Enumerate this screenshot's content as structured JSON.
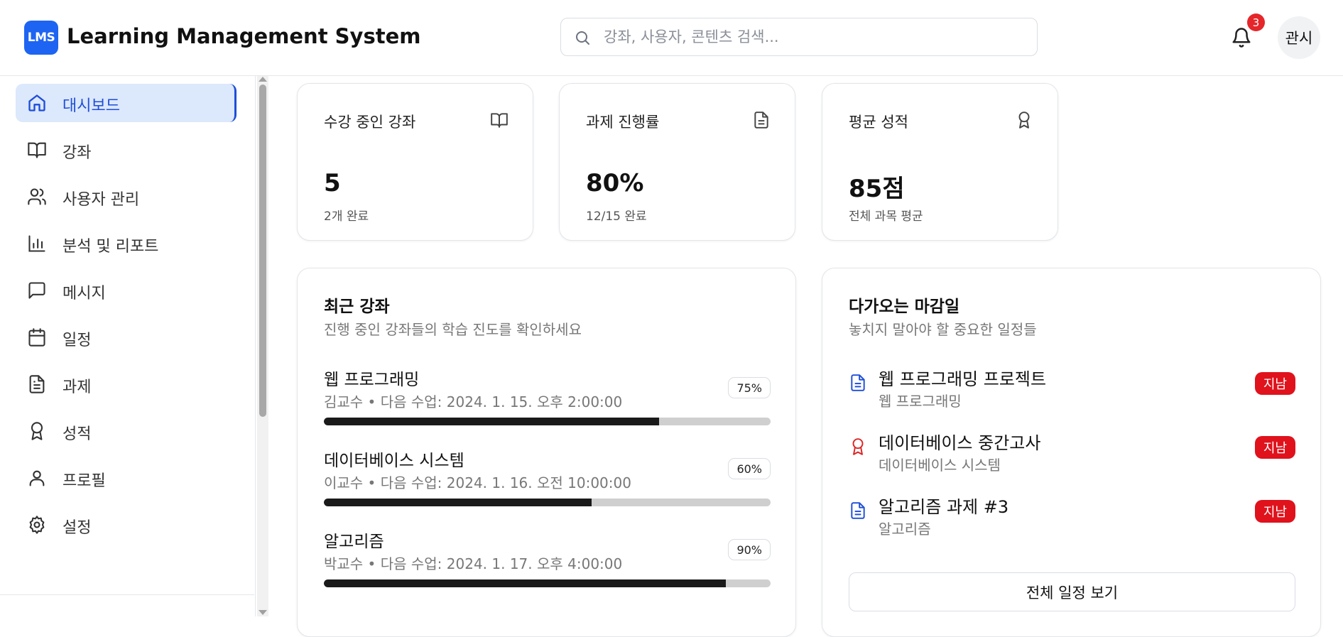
{
  "header": {
    "logo_text": "LMS",
    "app_title": "Learning Management System",
    "search_placeholder": "강좌, 사용자, 콘텐츠 검색...",
    "notification_count": "3",
    "user_name": "관시"
  },
  "sidebar": {
    "items": [
      {
        "label": "대시보드",
        "icon": "home-icon",
        "active": true
      },
      {
        "label": "강좌",
        "icon": "book-open-icon"
      },
      {
        "label": "사용자 관리",
        "icon": "users-icon"
      },
      {
        "label": "분석 및 리포트",
        "icon": "bar-chart-icon"
      },
      {
        "label": "메시지",
        "icon": "message-square-icon"
      },
      {
        "label": "일정",
        "icon": "calendar-icon"
      },
      {
        "label": "과제",
        "icon": "file-text-icon"
      },
      {
        "label": "성적",
        "icon": "award-icon"
      },
      {
        "label": "프로필",
        "icon": "user-icon"
      },
      {
        "label": "설정",
        "icon": "settings-icon"
      }
    ]
  },
  "stats": [
    {
      "title": "수강 중인 강좌",
      "value": "5",
      "sub": "2개 완료",
      "icon": "book-open-icon"
    },
    {
      "title": "과제 진행률",
      "value": "80%",
      "sub": "12/15 완료",
      "icon": "file-text-icon"
    },
    {
      "title": "평균 성적",
      "value": "85점",
      "sub": "전체 과목 평균",
      "icon": "award-icon"
    }
  ],
  "recent_courses": {
    "title": "최근 강좌",
    "subtitle": "진행 중인 강좌들의 학습 진도를 확인하세요",
    "items": [
      {
        "name": "웹 프로그래밍",
        "meta": "김교수 • 다음 수업: 2024. 1. 15. 오후 2:00:00",
        "progress_label": "75%",
        "progress": 0.75
      },
      {
        "name": "데이터베이스 시스템",
        "meta": "이교수 • 다음 수업: 2024. 1. 16. 오전 10:00:00",
        "progress_label": "60%",
        "progress": 0.6
      },
      {
        "name": "알고리즘",
        "meta": "박교수 • 다음 수업: 2024. 1. 17. 오후 4:00:00",
        "progress_label": "90%",
        "progress": 0.9
      }
    ]
  },
  "deadlines": {
    "title": "다가오는 마감일",
    "subtitle": "놓치지 말아야 할 중요한 일정들",
    "items": [
      {
        "name": "웹 프로그래밍 프로젝트",
        "course": "웹 프로그래밍",
        "status": "지남",
        "icon": "file-text-icon",
        "icon_color": "#1d4ed8"
      },
      {
        "name": "데이터베이스 중간고사",
        "course": "데이터베이스 시스템",
        "status": "지남",
        "icon": "award-icon",
        "icon_color": "#dc2626"
      },
      {
        "name": "알고리즘 과제 #3",
        "course": "알고리즘",
        "status": "지남",
        "icon": "file-text-icon",
        "icon_color": "#1d4ed8"
      }
    ],
    "view_all_label": "전체 일정 보기"
  },
  "colors": {
    "brand": "#1d64f2",
    "active_nav_bg": "#dce8fb",
    "overdue": "#e0121c",
    "progress_fill": "#1a1a1a"
  }
}
